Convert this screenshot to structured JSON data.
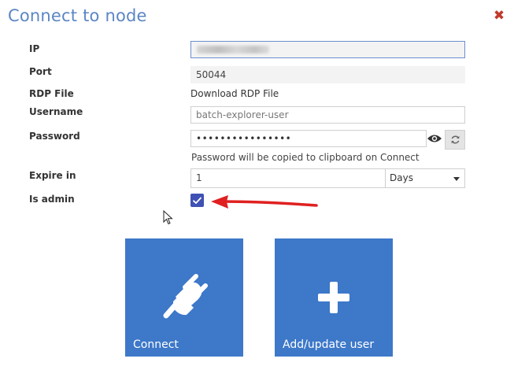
{
  "dialog": {
    "title": "Connect to node",
    "close_symbol": "✖"
  },
  "labels": {
    "ip": "IP",
    "port": "Port",
    "rdp_file": "RDP File",
    "username": "Username",
    "password": "Password",
    "expire_in": "Expire in",
    "is_admin": "Is admin"
  },
  "fields": {
    "ip_value": "",
    "port_value": "50044",
    "rdp_link_text": "Download RDP File",
    "username_value": "batch-explorer-user",
    "password_masked": "••••••••••••••••",
    "password_hint": "Password will be copied to clipboard on Connect",
    "expire_value": "1",
    "expire_unit": "Days",
    "is_admin_checked": true
  },
  "actions": {
    "connect_label": "Connect",
    "add_user_label": "Add/update user"
  },
  "icons": {
    "close": "close-icon",
    "show_password": "eye-icon",
    "regenerate_password": "refresh-icon",
    "dropdown": "chevron-down-icon",
    "connect": "plug-icon",
    "add_user": "plus-icon",
    "annotation": "red-arrow-icon",
    "mouse": "mouse-cursor-icon"
  },
  "colors": {
    "title": "#5b86c4",
    "close": "#c0392b",
    "tile": "#3d78c9",
    "checkbox": "#3f51b5",
    "annotation_arrow": "#e02020"
  }
}
